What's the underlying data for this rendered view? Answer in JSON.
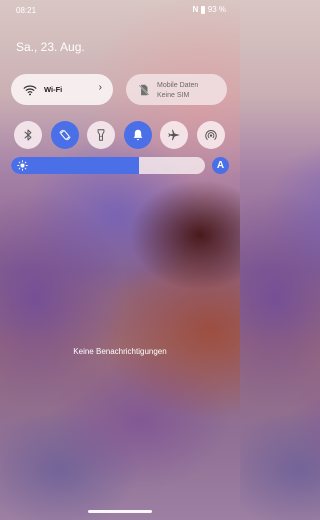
{
  "status_bar": {
    "time": "08:21",
    "nfc_label": "N",
    "battery_percent": "93 %"
  },
  "header": {
    "date": "Sa., 23. Aug."
  },
  "tiles": {
    "wifi": {
      "label": "Wi-Fi",
      "icon": "wifi-icon",
      "state": "on"
    },
    "mobile": {
      "label": "Mobile Daten",
      "sublabel": "Keine SIM",
      "icon": "sim-off-icon",
      "state": "unavailable"
    }
  },
  "toggles": [
    {
      "name": "bluetooth",
      "icon": "bluetooth-icon",
      "state": "off"
    },
    {
      "name": "auto-rotate",
      "icon": "rotate-icon",
      "state": "on"
    },
    {
      "name": "flashlight",
      "icon": "flashlight-icon",
      "state": "off"
    },
    {
      "name": "sound",
      "icon": "bell-icon",
      "state": "on"
    },
    {
      "name": "airplane-mode",
      "icon": "airplane-icon",
      "state": "off"
    },
    {
      "name": "hotspot",
      "icon": "hotspot-icon",
      "state": "off"
    }
  ],
  "brightness": {
    "level": 0.66,
    "icon": "sun-icon",
    "auto_label": "A"
  },
  "notifications": {
    "empty_text": "Keine Benachrichtigungen"
  },
  "colors": {
    "accent": "#4a6fe6",
    "tile_background": "#faf2f3"
  }
}
